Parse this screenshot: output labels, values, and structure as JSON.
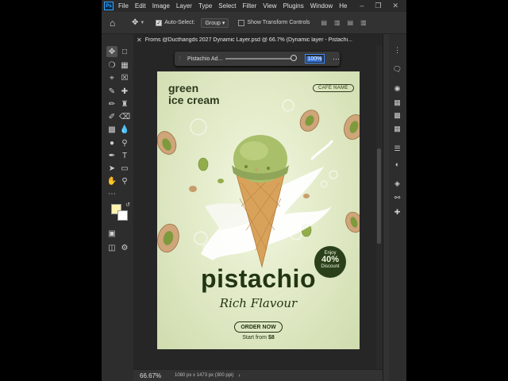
{
  "menubar": {
    "app_icon": "Ps",
    "items": [
      "File",
      "Edit",
      "Image",
      "Layer",
      "Type",
      "Select",
      "Filter",
      "View",
      "Plugins",
      "Window",
      "He"
    ]
  },
  "options": {
    "auto_select_label": "Auto-Select:",
    "auto_select_value": "Group",
    "transform_label": "Show Transform Controls"
  },
  "tab": {
    "title": "Froms @Ducthangds 2027 Dynamic Layer.psd @ 66.7% (Dynamic layer - Pistachi..."
  },
  "layer_popup": {
    "name": "Pistachio Ad...",
    "opacity": "100%"
  },
  "poster": {
    "heading_line1": "green",
    "heading_line2": "ice cream",
    "cafe_badge": "CAFÉ NAME",
    "title": "pistachio",
    "subtitle": "Rich Flavour",
    "badge_enjoy": "Enjoy",
    "badge_percent": "40%",
    "badge_discount": "Discount",
    "order_button": "ORDER NOW",
    "start_from": "Start from",
    "price": "$8"
  },
  "colors": {
    "foreground": "#fff3b0",
    "background": "#ffffff",
    "poster_dark_green": "#223514",
    "poster_bg": "#e3ebc9"
  },
  "status": {
    "zoom": "66.67%",
    "doc_info": "1080 px x 1473 px (300 ppi)"
  }
}
